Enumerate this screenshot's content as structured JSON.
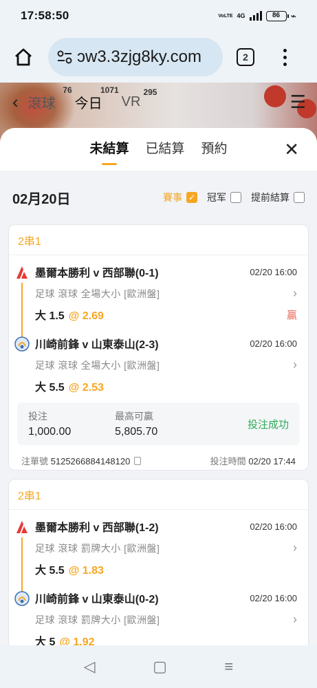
{
  "status_bar": {
    "time": "17:58:50",
    "network": "4G",
    "volte": "VoLTE",
    "battery": "86"
  },
  "browser": {
    "url": "ɔw3.3zjg8ky.com",
    "tab_count": "2"
  },
  "banner": {
    "tabs": [
      {
        "label": "滾球",
        "count": "76"
      },
      {
        "label": "今日",
        "count": "1071"
      },
      {
        "label": "VR",
        "count": "295"
      }
    ]
  },
  "sheet": {
    "tabs": [
      {
        "label": "未結算",
        "active": true
      },
      {
        "label": "已結算",
        "active": false
      },
      {
        "label": "預約",
        "active": false
      }
    ]
  },
  "filter": {
    "date": "02月20日",
    "options": [
      {
        "label": "賽事",
        "checked": true
      },
      {
        "label": "冠军",
        "checked": false
      },
      {
        "label": "提前結算",
        "checked": false
      }
    ]
  },
  "bets": [
    {
      "type": "2串1",
      "legs": [
        {
          "title": "墨爾本勝利 v 西部聯(0-1)",
          "time": "02/20 16:00",
          "meta": "足球 滾球 全場大小 [歐洲盤]",
          "pick": "大 1.5",
          "odds": "@ 2.69",
          "result": "贏"
        },
        {
          "title": "川崎前鋒 v 山東泰山(2-3)",
          "time": "02/20 16:00",
          "meta": "足球 滾球 全場大小 [歐洲盤]",
          "pick": "大 5.5",
          "odds": "@ 2.53",
          "result": ""
        }
      ],
      "stake_label": "投注",
      "stake": "1,000.00",
      "max_win_label": "最高可贏",
      "max_win": "5,805.70",
      "status": "投注成功",
      "order_label": "注單號",
      "order_no": "5125266884148120",
      "bet_time_label": "投注時間",
      "bet_time": "02/20 17:44"
    },
    {
      "type": "2串1",
      "legs": [
        {
          "title": "墨爾本勝利 v 西部聯(1-2)",
          "time": "02/20 16:00",
          "meta": "足球 滾球 罰牌大小 [歐洲盤]",
          "pick": "大 5.5",
          "odds": "@ 1.83",
          "result": ""
        },
        {
          "title": "川崎前鋒 v 山東泰山(0-2)",
          "time": "02/20 16:00",
          "meta": "足球 滾球 罰牌大小 [歐洲盤]",
          "pick": "大 5",
          "odds": "@ 1.92",
          "result": ""
        }
      ]
    }
  ],
  "colors": {
    "accent": "#f5a623",
    "win": "#e86a5b",
    "success": "#2eaa57"
  }
}
